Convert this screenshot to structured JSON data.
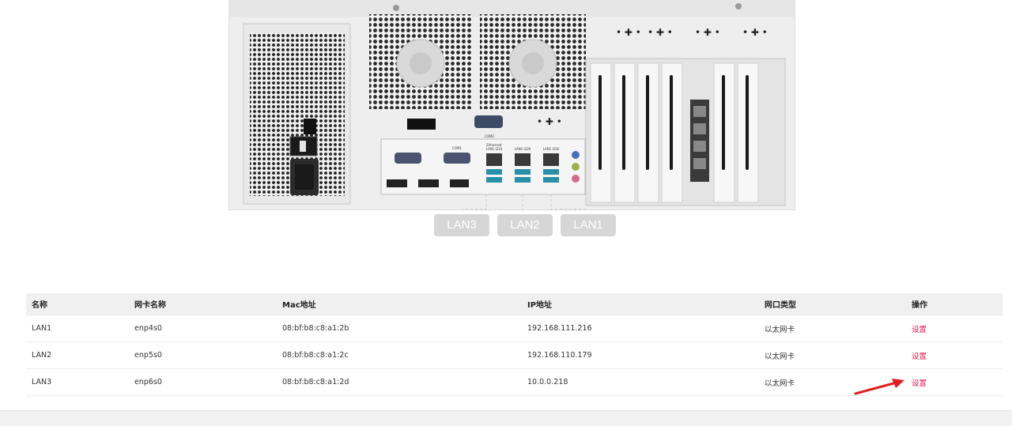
{
  "device": {
    "lan_buttons": [
      {
        "label": "LAN3"
      },
      {
        "label": "LAN2"
      },
      {
        "label": "LAN1"
      }
    ],
    "panel_labels": {
      "com1": "COM1",
      "com2": "COM2",
      "ethernet": "Ethernet",
      "lan1_210": "LAN1 I210",
      "lan1_226": "LAN1 I226",
      "lan1_228": "LAN1 I226"
    }
  },
  "table": {
    "columns": [
      "名称",
      "网卡名称",
      "Mac地址",
      "IP地址",
      "网口类型",
      "操作"
    ],
    "rows": [
      {
        "name": "LAN1",
        "nic": "enp4s0",
        "mac": "08:bf:b8:c8:a1:2b",
        "ip": "192.168.111.216",
        "type": "以太网卡",
        "action": "设置"
      },
      {
        "name": "LAN2",
        "nic": "enp5s0",
        "mac": "08:bf:b8:c8:a1:2c",
        "ip": "192.168.110.179",
        "type": "以太网卡",
        "action": "设置"
      },
      {
        "name": "LAN3",
        "nic": "enp6s0",
        "mac": "08:bf:b8:c8:a1:2d",
        "ip": "10.0.0.218",
        "type": "以太网卡",
        "action": "设置"
      }
    ]
  },
  "colors": {
    "action": "#e8194b",
    "arrow": "#e02020",
    "lan_button_bg": "#d6d6d6",
    "header_bg": "#f0f0f0"
  }
}
